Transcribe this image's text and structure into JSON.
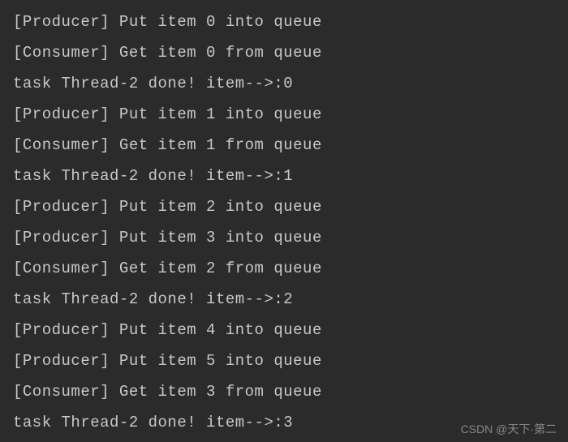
{
  "terminal": {
    "lines": [
      "[Producer] Put item 0 into queue",
      "[Consumer] Get item 0 from queue",
      "task Thread-2 done! item-->:0",
      "[Producer] Put item 1 into queue",
      "[Consumer] Get item 1 from queue",
      "task Thread-2 done! item-->:1",
      "[Producer] Put item 2 into queue",
      "[Producer] Put item 3 into queue",
      "[Consumer] Get item 2 from queue",
      "task Thread-2 done! item-->:2",
      "[Producer] Put item 4 into queue",
      "[Producer] Put item 5 into queue",
      "[Consumer] Get item 3 from queue",
      "task Thread-2 done! item-->:3"
    ]
  },
  "watermark": {
    "text": "CSDN @天下·第二"
  }
}
